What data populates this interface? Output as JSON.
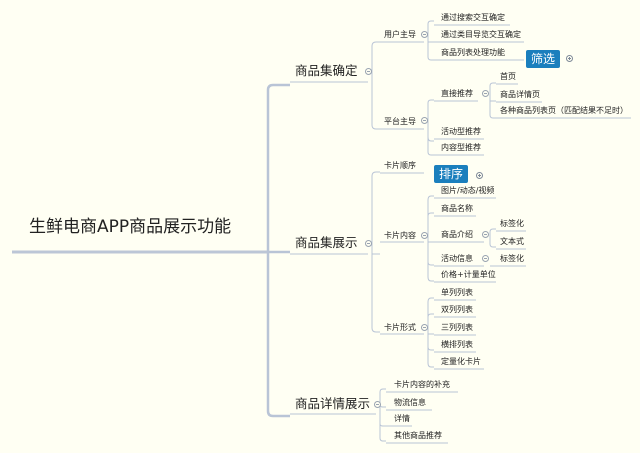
{
  "root": "生鲜电商APP商品展示功能",
  "branches": {
    "b1": {
      "label": "商品集确定",
      "user": {
        "label": "用户主导",
        "items": [
          "通过搜索交互确定",
          "通过类目导览交互确定",
          "商品列表处理功能"
        ],
        "tag": "筛选"
      },
      "platform": {
        "label": "平台主导",
        "direct": {
          "label": "直接推荐",
          "items": [
            "首页",
            "商品详情页",
            "各种商品列表页（匹配结果不足时）"
          ]
        },
        "activity": "活动型推荐",
        "content": "内容型推荐"
      }
    },
    "b2": {
      "label": "商品集展示",
      "order": {
        "label": "卡片顺序",
        "tag": "排序"
      },
      "content": {
        "label": "卡片内容",
        "items": [
          "图片/动态/视频",
          "商品名称",
          "商品介绍",
          "活动信息",
          "价格+计量单位"
        ],
        "intro_subs": [
          "标签化",
          "文本式"
        ],
        "activity_subs": [
          "标签化"
        ]
      },
      "form": {
        "label": "卡片形式",
        "items": [
          "单列列表",
          "双列列表",
          "三列列表",
          "横排列表",
          "定量化卡片"
        ]
      }
    },
    "b3": {
      "label": "商品详情展示",
      "items": [
        "卡片内容的补充",
        "物流信息",
        "详情",
        "其他商品推荐"
      ]
    }
  },
  "colors": {
    "background": "#fffff3",
    "line": "#b9c4d6",
    "tag": "#1b7fbd"
  }
}
